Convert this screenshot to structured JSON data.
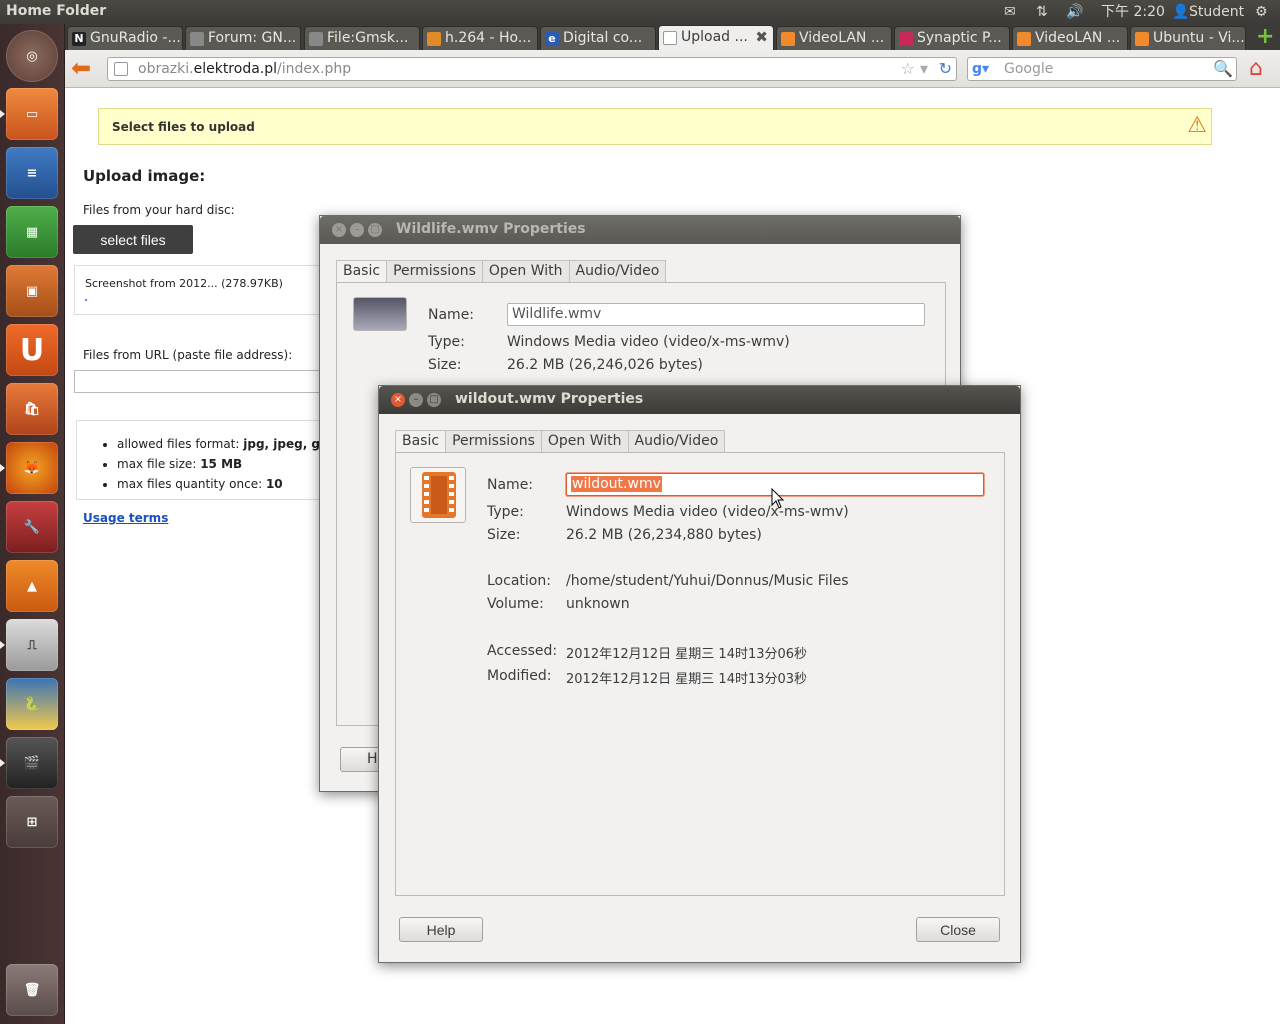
{
  "panel": {
    "title": "Home Folder",
    "clock": "下午 2:20",
    "user": "Student",
    "icons": [
      "mail-icon",
      "network-icon",
      "volume-icon",
      "user-icon",
      "gear-icon"
    ]
  },
  "launcher": {
    "items": [
      "ubuntu-dash",
      "home-folder",
      "libreoffice-writer",
      "libreoffice-calc",
      "libreoffice-impress",
      "ubuntu-one",
      "software-center",
      "firefox",
      "system-settings",
      "vlc",
      "gnuradio-companion",
      "python",
      "video-editor",
      "workspace-switcher",
      "trash"
    ]
  },
  "browser": {
    "tabs": [
      {
        "label": "GnuRadio -...",
        "icon": "N"
      },
      {
        "label": "Forum: GN...",
        "icon": ""
      },
      {
        "label": "File:Gmsk...",
        "icon": ""
      },
      {
        "label": "h.264 - Ho...",
        "icon": ""
      },
      {
        "label": "Digital co...",
        "icon": "e"
      },
      {
        "label": "Upload ...",
        "icon": ""
      },
      {
        "label": "VideoLAN ...",
        "icon": ""
      },
      {
        "label": "Synaptic P...",
        "icon": ""
      },
      {
        "label": "VideoLAN ...",
        "icon": ""
      },
      {
        "label": "Ubuntu - Vi...",
        "icon": ""
      }
    ],
    "url_prefix": "obrazki.",
    "url_domain": "elektroda.pl",
    "url_path": "/index.php",
    "search_placeholder": "Google"
  },
  "page": {
    "notice": "Select files to upload",
    "upload_title": "Upload image:",
    "hd_label": "Files from your hard disc:",
    "select_files": "select files",
    "file_entry": "Screenshot from 2012... (278.97KB)",
    "url_label": "Files from URL (paste file address):",
    "rules": [
      {
        "prefix": "allowed files format: ",
        "value": "jpg, jpeg, gif, p"
      },
      {
        "prefix": "max file size: ",
        "value": "15 MB"
      },
      {
        "prefix": "max files quantity once: ",
        "value": "10"
      }
    ],
    "usage_terms": "Usage terms"
  },
  "dialog_back": {
    "title": "Wildlife.wmv Properties",
    "tabs": [
      "Basic",
      "Permissions",
      "Open With",
      "Audio/Video"
    ],
    "name_label": "Name:",
    "name_value": "Wildlife.wmv",
    "type_label": "Type:",
    "type_value": "Windows Media video (video/x-ms-wmv)",
    "size_label": "Size:",
    "size_value": "26.2 MB (26,246,026 bytes)",
    "help_partial": "H"
  },
  "dialog_front": {
    "title": "wildout.wmv Properties",
    "tabs": [
      "Basic",
      "Permissions",
      "Open With",
      "Audio/Video"
    ],
    "name_label": "Name:",
    "name_value": "wildout.wmv",
    "type_label": "Type:",
    "type_value": "Windows Media video (video/x-ms-wmv)",
    "size_label": "Size:",
    "size_value": "26.2 MB (26,234,880 bytes)",
    "location_label": "Location:",
    "location_value": "/home/student/Yuhui/Donnus/Music Files",
    "volume_label": "Volume:",
    "volume_value": "unknown",
    "accessed_label": "Accessed:",
    "accessed_value": "2012年12月12日 星期三 14时13分06秒",
    "modified_label": "Modified:",
    "modified_value": "2012年12月12日 星期三 14时13分03秒",
    "help_button": "Help",
    "close_button": "Close"
  },
  "colors": {
    "accent": "#e05a32",
    "notice_bg": "#ffffcc",
    "selection": "#f07746"
  }
}
